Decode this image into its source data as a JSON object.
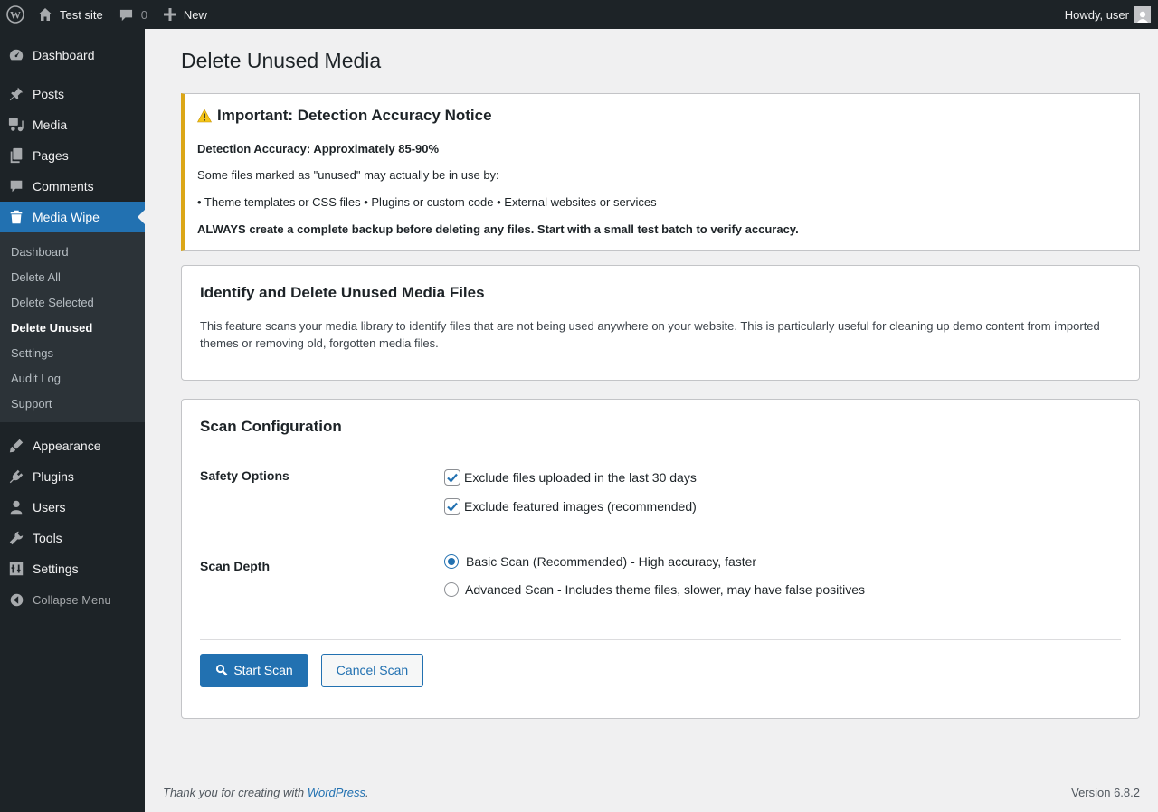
{
  "adminbar": {
    "site_name": "Test site",
    "comments_count": "0",
    "new_label": "New",
    "howdy": "Howdy, user"
  },
  "sidebar": {
    "items": [
      {
        "label": "Dashboard",
        "icon": "dashboard-icon"
      },
      {
        "label": "Posts",
        "icon": "pin-icon"
      },
      {
        "label": "Media",
        "icon": "media-icon"
      },
      {
        "label": "Pages",
        "icon": "pages-icon"
      },
      {
        "label": "Comments",
        "icon": "comment-icon"
      },
      {
        "label": "Media Wipe",
        "icon": "trash-icon"
      }
    ],
    "submenu": [
      "Dashboard",
      "Delete All",
      "Delete Selected",
      "Delete Unused",
      "Settings",
      "Audit Log",
      "Support"
    ],
    "items_after": [
      {
        "label": "Appearance",
        "icon": "brush-icon"
      },
      {
        "label": "Plugins",
        "icon": "plugin-icon"
      },
      {
        "label": "Users",
        "icon": "user-icon"
      },
      {
        "label": "Tools",
        "icon": "wrench-icon"
      },
      {
        "label": "Settings",
        "icon": "settings-icon"
      }
    ],
    "collapse": "Collapse Menu"
  },
  "page": {
    "title": "Delete Unused Media"
  },
  "notice": {
    "title": "Important: Detection Accuracy Notice",
    "accuracy": "Detection Accuracy: Approximately 85-90%",
    "intro": "Some files marked as \"unused\" may actually be in use by:",
    "list": "• Theme templates or CSS files • Plugins or custom code • External websites or services",
    "warning": "ALWAYS create a complete backup before deleting any files. Start with a small test batch to verify accuracy."
  },
  "intro_card": {
    "title": "Identify and Delete Unused Media Files",
    "description": "This feature scans your media library to identify files that are not being used anywhere on your website. This is particularly useful for cleaning up demo content from imported themes or removing old, forgotten media files."
  },
  "config": {
    "title": "Scan Configuration",
    "safety_label": "Safety Options",
    "safety_options": [
      {
        "label": "Exclude files uploaded in the last 30 days",
        "checked": true
      },
      {
        "label": "Exclude featured images (recommended)",
        "checked": true
      }
    ],
    "depth_label": "Scan Depth",
    "depth_options": [
      {
        "label": "Basic Scan (Recommended) - High accuracy, faster",
        "selected": true
      },
      {
        "label": "Advanced Scan - Includes theme files, slower, may have false positives",
        "selected": false
      }
    ],
    "start_button": "Start Scan",
    "cancel_button": "Cancel Scan"
  },
  "footer": {
    "thanks_prefix": "Thank you for creating with ",
    "link": "WordPress",
    "thanks_suffix": ".",
    "version": "Version 6.8.2"
  },
  "colors": {
    "accent": "#2271b1",
    "adminbar": "#1d2327",
    "notice_border": "#dba617"
  }
}
